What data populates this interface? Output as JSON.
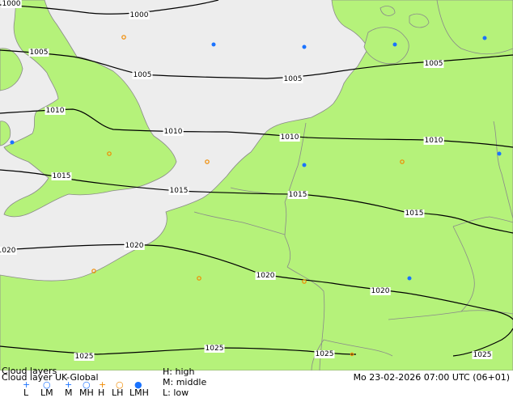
{
  "map": {
    "isobars": [
      {
        "label": "1000"
      },
      {
        "label": "1000"
      },
      {
        "label": "1005"
      },
      {
        "label": "1005"
      },
      {
        "label": "1005"
      },
      {
        "label": "1005"
      },
      {
        "label": "1010"
      },
      {
        "label": "1010"
      },
      {
        "label": "1010"
      },
      {
        "label": "1010"
      },
      {
        "label": "1015"
      },
      {
        "label": "1015"
      },
      {
        "label": "1015"
      },
      {
        "label": "1015"
      },
      {
        "label": "1020"
      },
      {
        "label": "1020"
      },
      {
        "label": "1020"
      },
      {
        "label": "1020"
      },
      {
        "label": "1025"
      },
      {
        "label": "1025"
      },
      {
        "label": "1025"
      },
      {
        "label": "1025"
      }
    ],
    "colors": {
      "land": "#b5f27a",
      "sea": "#ededed",
      "cloud_low_high_marker": "#1a73ff",
      "cloud_middle_marker": "#f08a00"
    }
  },
  "footer": {
    "title": "Cloud layers",
    "subtitle": "Cloud layer  UK-Global",
    "legend_codes": [
      "L",
      "LM",
      "M",
      "MH",
      "H",
      "LH",
      "LMH"
    ],
    "legend_icons": [
      "plus-blue",
      "ring-blue",
      "plus-blue",
      "ring-blue",
      "plus-orange",
      "ring-orange",
      "dot-blue"
    ],
    "levels": {
      "high": "H: high",
      "middle": "M: middle",
      "low": "L: low"
    },
    "datetime": "Mo 23-02-2026 07:00 UTC (06+01)"
  }
}
